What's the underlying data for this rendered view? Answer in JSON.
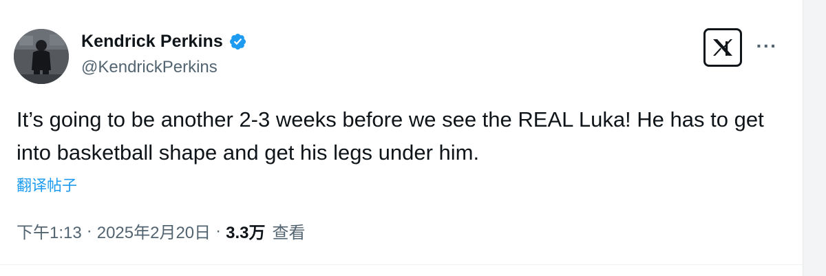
{
  "author": {
    "display_name": "Kendrick Perkins",
    "handle": "@KendrickPerkins",
    "verified": true,
    "verified_color": "#1d9bf0"
  },
  "header_actions": {
    "logo_icon": "x-logo-icon",
    "more_label": "···"
  },
  "tweet": {
    "text": "It’s going to be another 2-3 weeks before we see the REAL Luka! He has to get into basketball shape and get his legs under him.",
    "translate_label": "翻译帖子"
  },
  "meta": {
    "time": "下午1:13",
    "separator": "·",
    "date": "2025年2月20日",
    "views_count": "3.3万",
    "views_label": "查看"
  },
  "colors": {
    "text_primary": "#0f1419",
    "text_secondary": "#536471",
    "link": "#1d9bf0"
  }
}
